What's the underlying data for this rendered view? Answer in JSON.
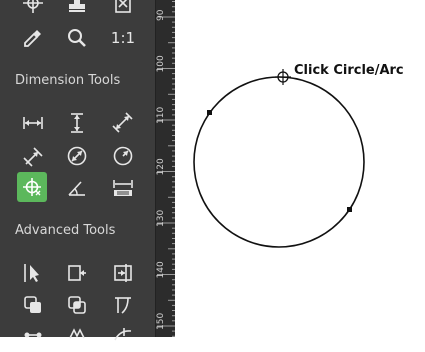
{
  "toolbar": {
    "sections": [
      {
        "label": "Dimension Tools"
      },
      {
        "label": "Advanced Tools"
      }
    ],
    "top_tools": [
      {
        "icon": "crosshair-move-icon"
      },
      {
        "icon": "stamp-icon"
      },
      {
        "icon": "document-x-icon"
      },
      {
        "icon": "eyedropper-icon"
      },
      {
        "icon": "magnifier-icon"
      },
      {
        "icon": "actual-size-icon",
        "label": "1:1"
      }
    ],
    "dimension_tools": [
      {
        "icon": "horizontal-dimension-icon"
      },
      {
        "icon": "vertical-dimension-icon"
      },
      {
        "icon": "aligned-dimension-icon"
      },
      {
        "icon": "angled-dimension-icon"
      },
      {
        "icon": "diameter-dimension-icon"
      },
      {
        "icon": "radius-dimension-icon"
      },
      {
        "icon": "center-mark-icon",
        "active": true
      },
      {
        "icon": "angle-dimension-icon"
      },
      {
        "icon": "scale-bar-icon"
      }
    ],
    "advanced_tools": [
      {
        "icon": "select-arrow-icon"
      },
      {
        "icon": "extend-left-icon"
      },
      {
        "icon": "extend-right-icon"
      },
      {
        "icon": "union-icon"
      },
      {
        "icon": "intersect-icon"
      },
      {
        "icon": "trim-icon"
      }
    ]
  },
  "ruler": {
    "labels": [
      "90",
      "100",
      "110",
      "120",
      "130",
      "140",
      "150"
    ]
  },
  "canvas": {
    "prompt": "Click Circle/Arc"
  },
  "colors": {
    "toolbar_bg": "#3c3c3c",
    "ruler_bg": "#2c2c2c",
    "active_tool": "#5cb85c",
    "icon": "#e6e6e6"
  }
}
